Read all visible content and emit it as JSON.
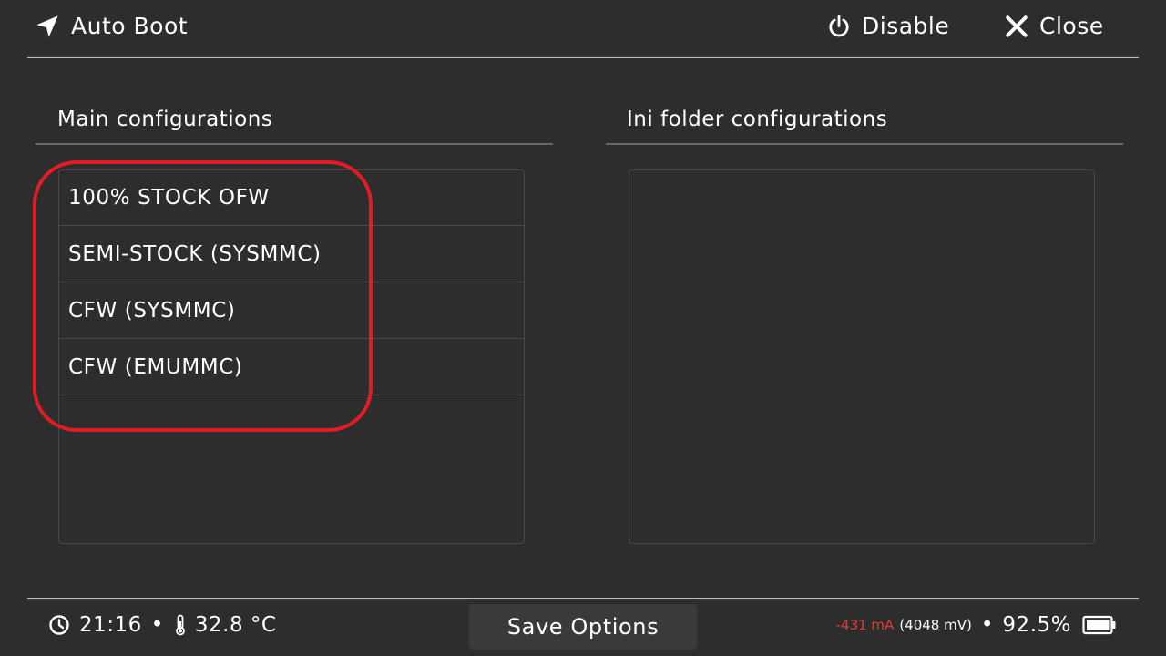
{
  "header": {
    "title": "Auto Boot",
    "title_icon": "navigation-arrow-icon",
    "disable_label": "Disable",
    "close_label": "Close"
  },
  "main_panel": {
    "title": "Main configurations",
    "items": [
      {
        "label": "100% STOCK OFW"
      },
      {
        "label": "SEMI-STOCK (SYSMMC)"
      },
      {
        "label": "CFW (SYSMMC)"
      },
      {
        "label": "CFW (EMUMMC)"
      }
    ]
  },
  "ini_panel": {
    "title": "Ini folder configurations",
    "items": []
  },
  "footer": {
    "time": "21:16",
    "separator": "•",
    "temperature": "32.8 °C",
    "save_label": "Save Options",
    "current": "-431 mA",
    "voltage": "(4048 mV)",
    "battery": "92.5%"
  },
  "colors": {
    "background": "#2d2d2d",
    "highlight": "#e21c25",
    "current_text": "#e23b3b"
  }
}
